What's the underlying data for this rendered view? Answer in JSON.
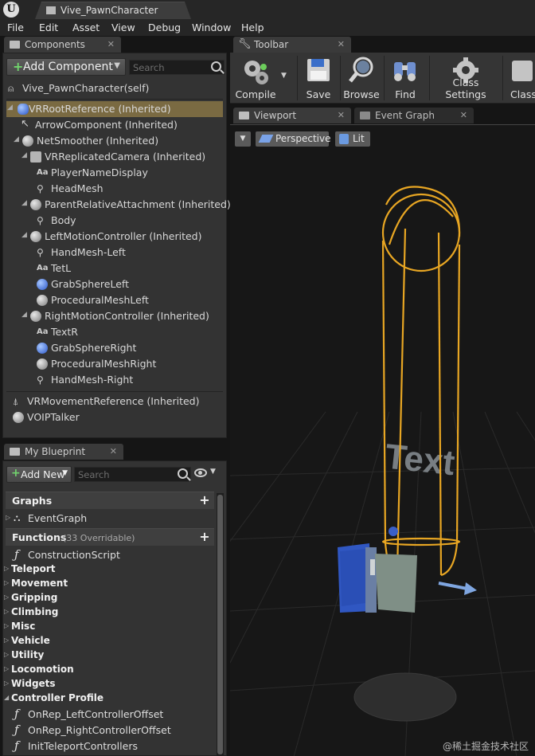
{
  "window": {
    "logo": "U",
    "doc_tab": "Vive_PawnCharacter"
  },
  "menu": [
    "File",
    "Edit",
    "Asset",
    "View",
    "Debug",
    "Window",
    "Help"
  ],
  "components": {
    "tab": "Components",
    "add_button": "Add Component",
    "search_placeholder": "Search",
    "self_label": "Vive_PawnCharacter(self)",
    "rows": [
      {
        "label": "VRRootReference (Inherited)",
        "icon": "capsule-icon"
      },
      {
        "label": "ArrowComponent (Inherited)",
        "icon": "arrow-icon"
      },
      {
        "label": "NetSmoother (Inherited)",
        "icon": "scene-icon"
      },
      {
        "label": "VRReplicatedCamera (Inherited)",
        "icon": "camera-icon"
      },
      {
        "label": "PlayerNameDisplay",
        "icon": "text-render-icon"
      },
      {
        "label": "HeadMesh",
        "icon": "skeletal-mesh-icon"
      },
      {
        "label": "ParentRelativeAttachment (Inherited)",
        "icon": "scene-icon"
      },
      {
        "label": "Body",
        "icon": "skeletal-mesh-icon"
      },
      {
        "label": "LeftMotionController (Inherited)",
        "icon": "scene-icon"
      },
      {
        "label": "HandMesh-Left",
        "icon": "skeletal-mesh-icon"
      },
      {
        "label": "TetL",
        "icon": "text-render-icon"
      },
      {
        "label": "GrabSphereLeft",
        "icon": "sphere-collision-icon"
      },
      {
        "label": "ProceduralMeshLeft",
        "icon": "procedural-mesh-icon"
      },
      {
        "label": "RightMotionController (Inherited)",
        "icon": "scene-icon"
      },
      {
        "label": "TextR",
        "icon": "text-render-icon"
      },
      {
        "label": "GrabSphereRight",
        "icon": "sphere-collision-icon"
      },
      {
        "label": "ProceduralMeshRight",
        "icon": "procedural-mesh-icon"
      },
      {
        "label": "HandMesh-Right",
        "icon": "skeletal-mesh-icon"
      },
      {
        "label": "VRMovementReference (Inherited)",
        "icon": "movement-icon"
      },
      {
        "label": "VOIPTalker",
        "icon": "voip-icon"
      }
    ]
  },
  "blueprint": {
    "tab": "My Blueprint",
    "add_button": "Add New",
    "search_placeholder": "Search",
    "graphs_header": "Graphs",
    "event_graph": "EventGraph",
    "functions_header": "Functions",
    "functions_sub": "(33 Overridable)",
    "construction_script": "ConstructionScript",
    "categories": [
      "Teleport",
      "Movement",
      "Gripping",
      "Climbing",
      "Misc",
      "Vehicle",
      "Utility",
      "Locomotion",
      "Widgets",
      "Controller Profile"
    ],
    "functions": [
      "OnRep_LeftControllerOffset",
      "OnRep_RightControllerOffset",
      "InitTeleportControllers"
    ]
  },
  "toolbar": {
    "tab": "Toolbar",
    "buttons": [
      "Compile",
      "Save",
      "Browse",
      "Find",
      "Class Settings",
      "Class"
    ]
  },
  "viewport": {
    "tabs": [
      "Viewport",
      "Event Graph"
    ],
    "perspective": "Perspective",
    "lit": "Lit",
    "world_text": "Text"
  },
  "colors": {
    "capsule_outline": "#e8a623",
    "selection": "#7a6a42",
    "add_plus": "#71d46d"
  },
  "watermark": "@稀土掘金技术社区"
}
